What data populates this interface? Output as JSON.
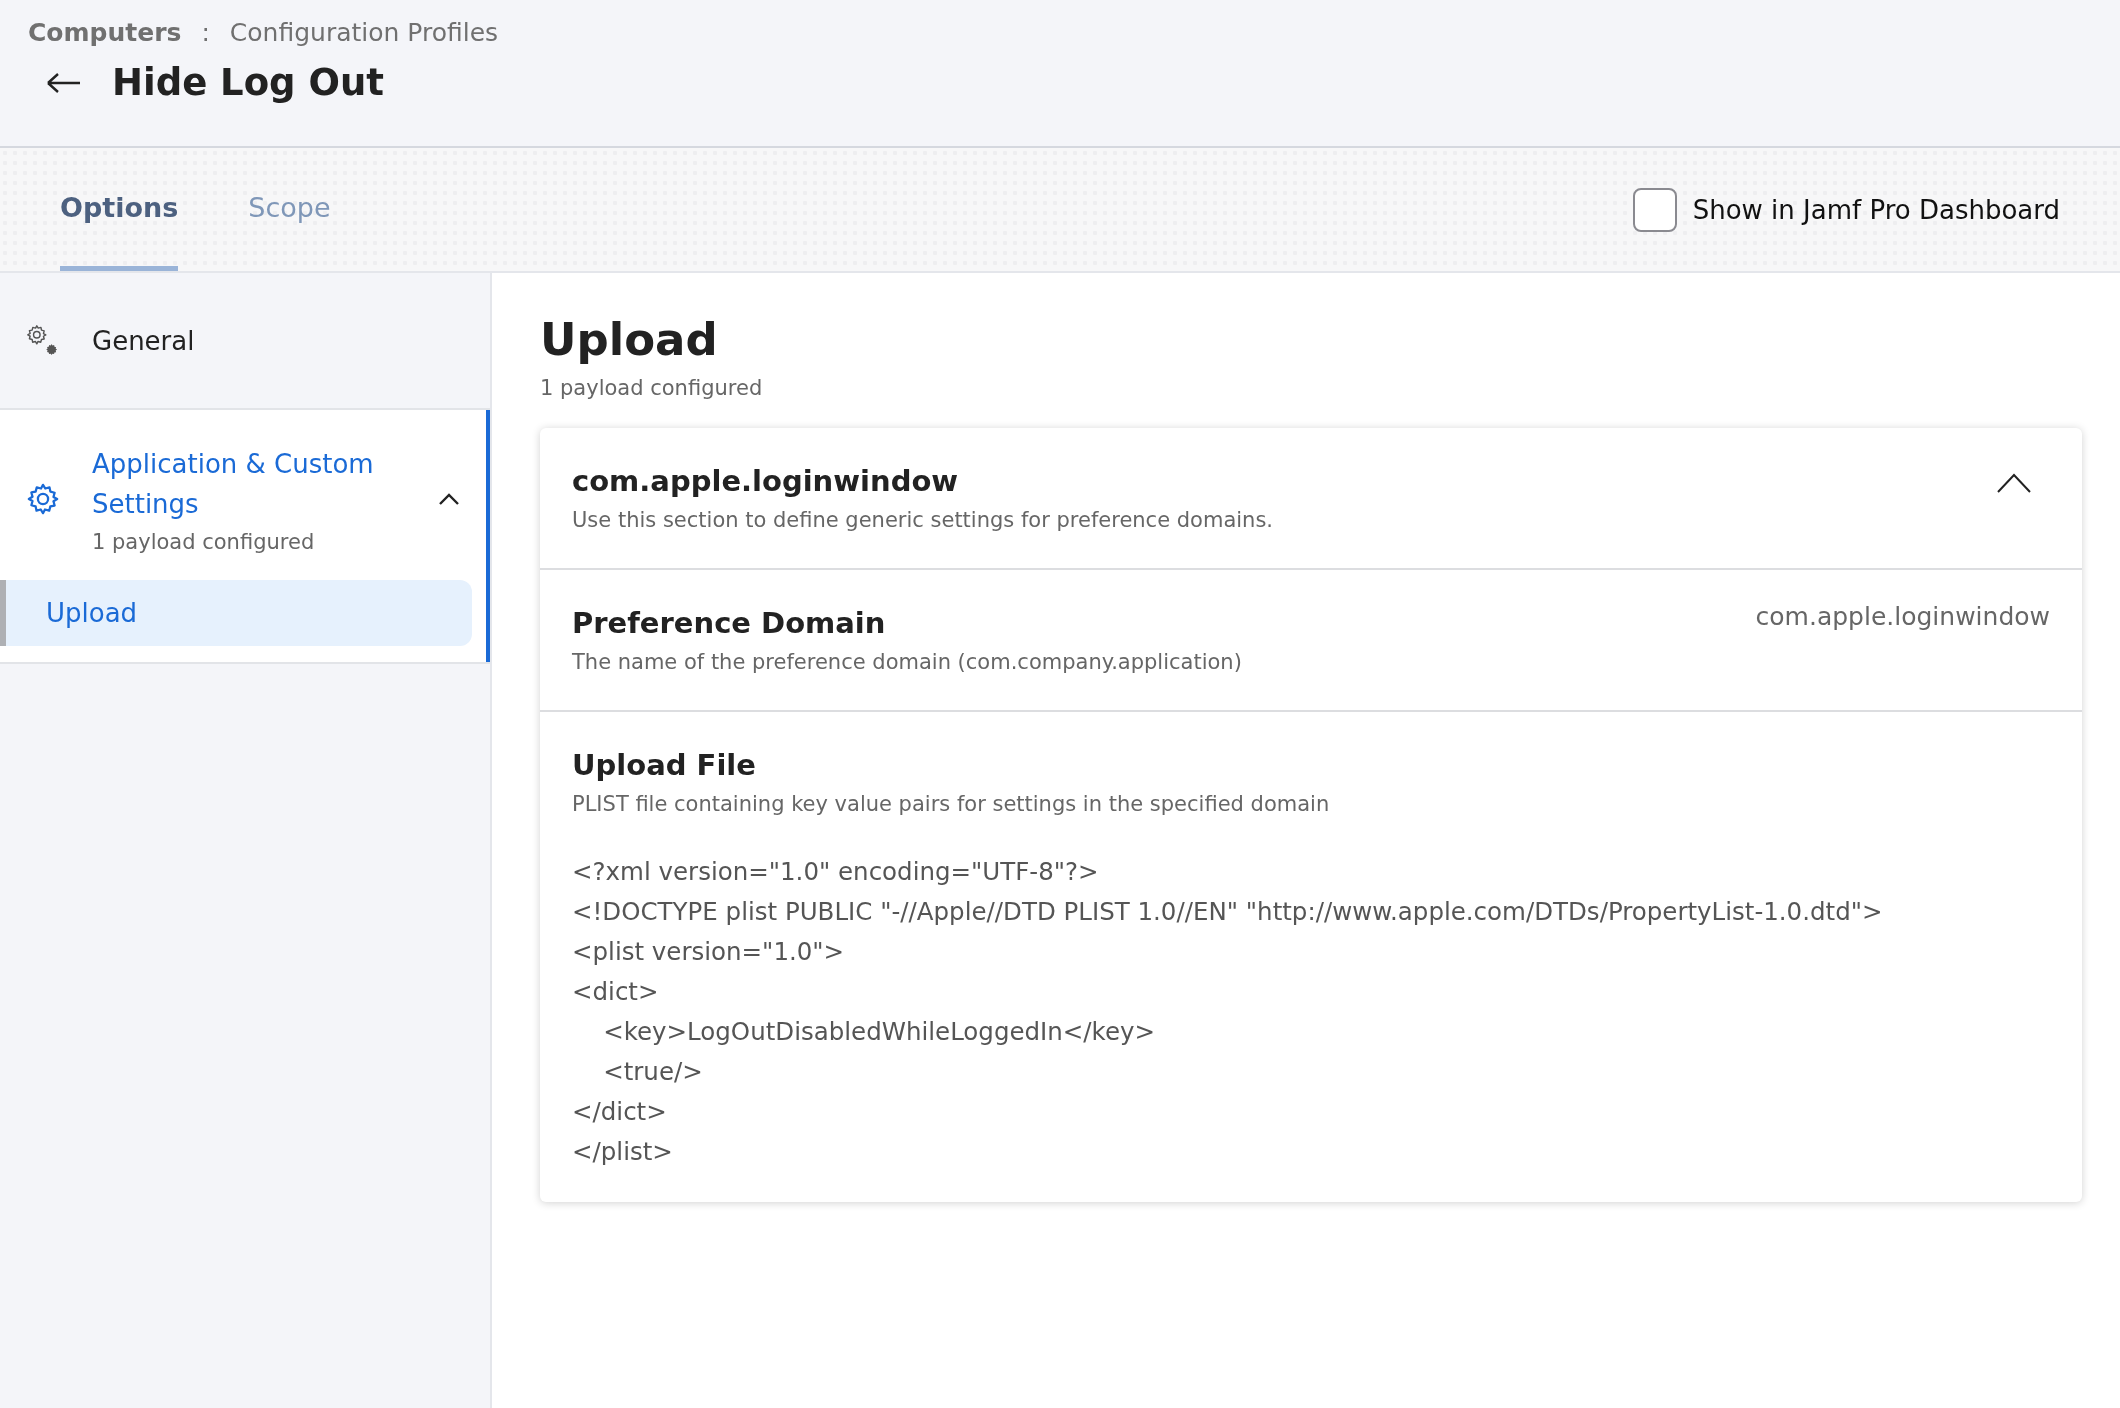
{
  "breadcrumb": {
    "section": "Computers",
    "separator": ":",
    "page": "Configuration Profiles"
  },
  "title": "Hide Log Out",
  "tabs": [
    {
      "label": "Options",
      "selected": true
    },
    {
      "label": "Scope",
      "selected": false
    }
  ],
  "dashboard_checkbox": {
    "label": "Show in Jamf Pro Dashboard",
    "checked": false
  },
  "sidebar": {
    "items": [
      {
        "kind": "link",
        "label": "General",
        "selected": false
      },
      {
        "kind": "group",
        "label": "Application & Custom Settings",
        "subtitle": "1 payload configured",
        "expanded": true,
        "selected": true,
        "children": [
          {
            "label": "Upload",
            "selected": true
          }
        ]
      }
    ]
  },
  "main": {
    "title": "Upload",
    "subtitle": "1 payload configured",
    "card": {
      "title": "com.apple.loginwindow",
      "description": "Use this section to define generic settings for preference domains.",
      "expanded": true,
      "fields": [
        {
          "kind": "value",
          "label": "Preference Domain",
          "description": "The name of the preference domain (com.company.application)",
          "value": "com.apple.loginwindow"
        },
        {
          "kind": "code",
          "label": "Upload File",
          "description": "PLIST file containing key value pairs for settings in the specified domain",
          "lines": [
            "<?xml version=\"1.0\" encoding=\"UTF-8\"?>",
            "<!DOCTYPE plist PUBLIC \"-//Apple//DTD PLIST 1.0//EN\" \"http://www.apple.com/DTDs/PropertyList-1.0.dtd\">",
            "<plist version=\"1.0\">",
            "<dict>",
            "    <key>LogOutDisabledWhileLoggedIn</key>",
            "    <true/>",
            "</dict>",
            "</plist>"
          ]
        }
      ]
    }
  }
}
